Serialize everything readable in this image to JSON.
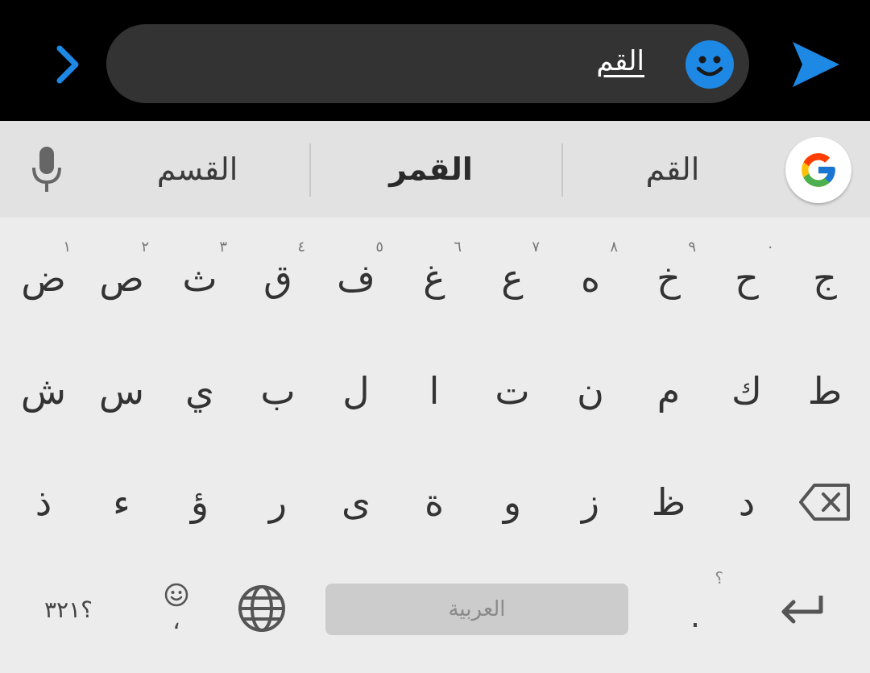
{
  "compose": {
    "message_text": "القم"
  },
  "suggestions": {
    "items": [
      "القسم",
      "القمر",
      "القم"
    ]
  },
  "keyboard": {
    "row1": [
      {
        "glyph": "ض",
        "hint": "١"
      },
      {
        "glyph": "ص",
        "hint": "٢"
      },
      {
        "glyph": "ث",
        "hint": "٣"
      },
      {
        "glyph": "ق",
        "hint": "٤"
      },
      {
        "glyph": "ف",
        "hint": "٥"
      },
      {
        "glyph": "غ",
        "hint": "٦"
      },
      {
        "glyph": "ع",
        "hint": "٧"
      },
      {
        "glyph": "ه",
        "hint": "٨"
      },
      {
        "glyph": "خ",
        "hint": "٩"
      },
      {
        "glyph": "ح",
        "hint": "٠"
      },
      {
        "glyph": "ج",
        "hint": ""
      }
    ],
    "row2": [
      "ش",
      "س",
      "ي",
      "ب",
      "ل",
      "ا",
      "ت",
      "ن",
      "م",
      "ك",
      "ط"
    ],
    "row3": [
      "ذ",
      "ء",
      "ؤ",
      "ر",
      "ى",
      "ة",
      "و",
      "ز",
      "ظ",
      "د"
    ],
    "symbols_label": "؟٣٢١",
    "comma_label": "،",
    "space_label": "العربية",
    "period_label": ".",
    "period_hint": "؟"
  },
  "colors": {
    "accent_blue": "#1e88e5",
    "keyboard_bg": "#ececec",
    "strip_bg": "#e2e2e2",
    "field_bg": "#333333"
  },
  "icons": [
    "chevron-right-icon",
    "smiley-icon",
    "send-icon",
    "microphone-icon",
    "google-icon",
    "backspace-icon",
    "emoji-icon",
    "globe-icon",
    "enter-icon"
  ]
}
